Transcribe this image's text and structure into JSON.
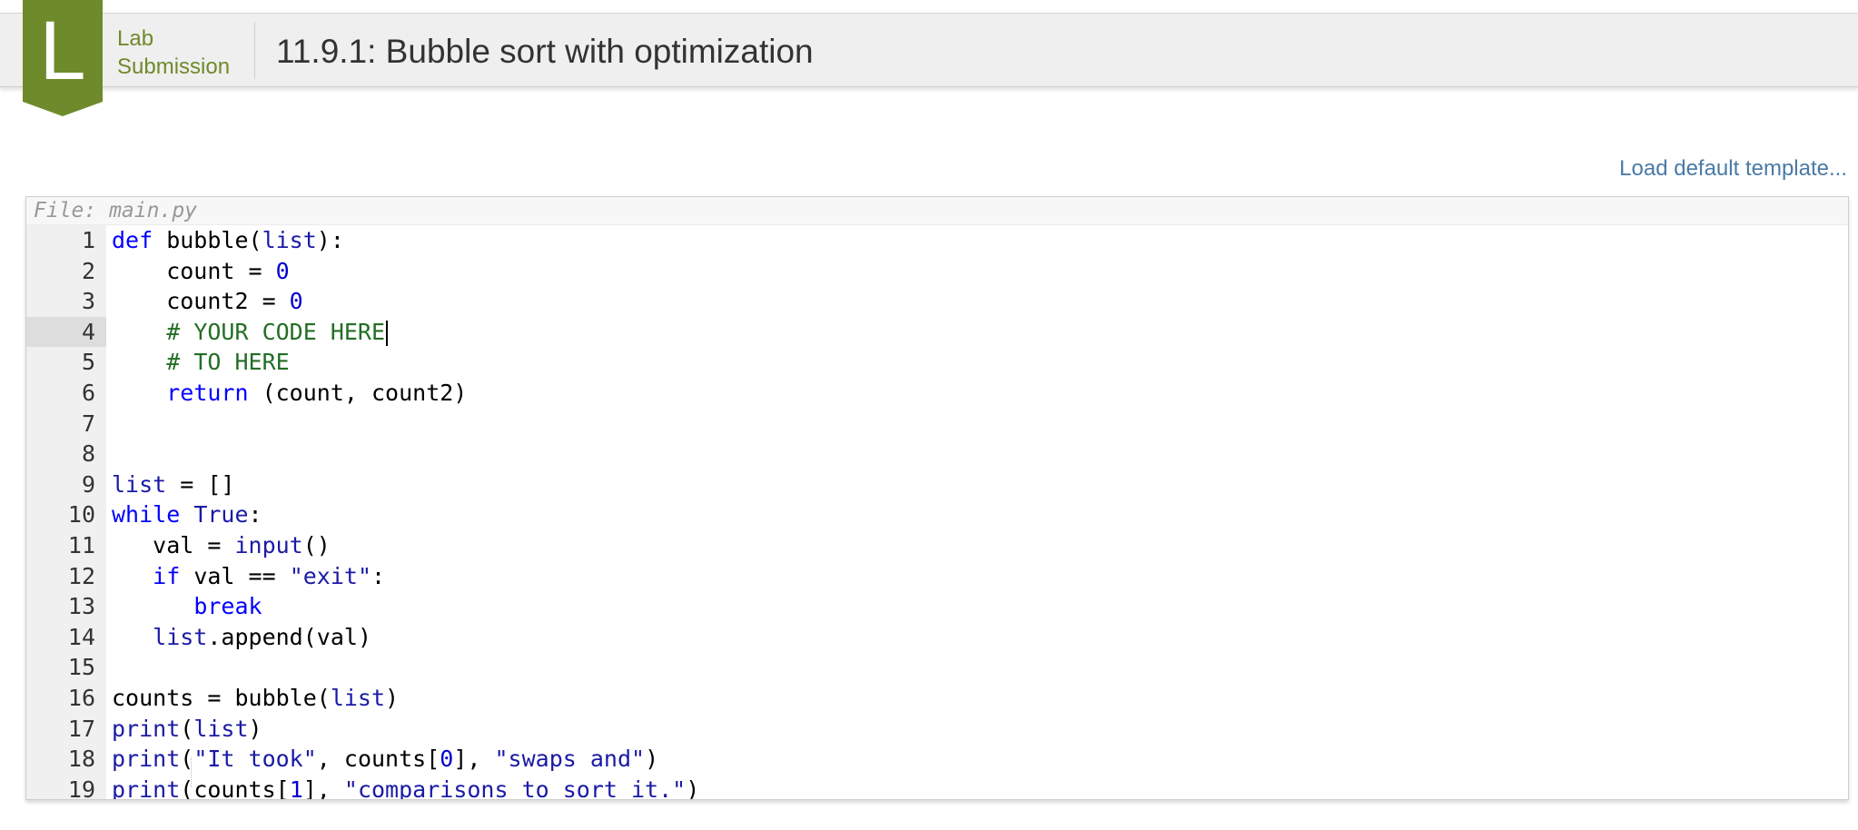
{
  "header": {
    "badge_letter": "L",
    "type_label": "Lab\nSubmission",
    "title": "11.9.1: Bubble sort with optimization",
    "badge_color": "#6f8a2a"
  },
  "load_template_link": "Load default template...",
  "editor": {
    "file_label": "File: main.py",
    "active_line": 4,
    "lines": [
      "def bubble(list):",
      "    count = 0",
      "    count2 = 0",
      "    # YOUR CODE HERE",
      "    # TO HERE",
      "    return (count, count2)",
      "",
      "",
      "list = []",
      "while True:",
      "   val = input()",
      "   if val == \"exit\":",
      "      break",
      "   list.append(val)",
      "",
      "counts = bubble(list)",
      "print(list)",
      "print(\"It took\", counts[0], \"swaps and\")",
      "print(counts[1], \"comparisons to sort it.\")"
    ]
  }
}
